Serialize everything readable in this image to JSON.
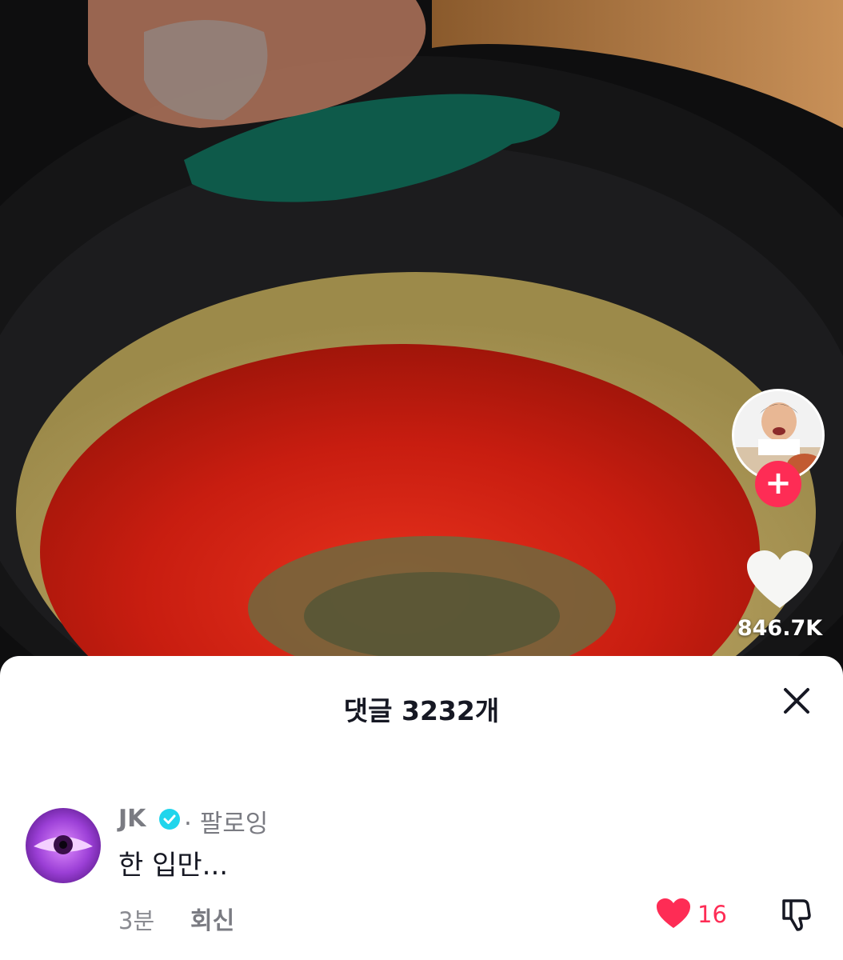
{
  "video": {
    "like_count": "846.7K",
    "creator_avatar": "creator-avatar",
    "follow_icon": "plus-icon"
  },
  "comments_sheet": {
    "title": "댓글 3232개",
    "close_icon": "close-icon",
    "comments": [
      {
        "username": "JK",
        "verified": true,
        "follow_status": "· 팔로잉",
        "text": "한 입만...",
        "time": "3분",
        "reply_label": "회신",
        "like_count": "16",
        "liked": true
      }
    ]
  },
  "colors": {
    "accent": "#fe2c55",
    "verified": "#20d5ec",
    "text_primary": "#161823",
    "text_secondary": "#7a7b82"
  }
}
